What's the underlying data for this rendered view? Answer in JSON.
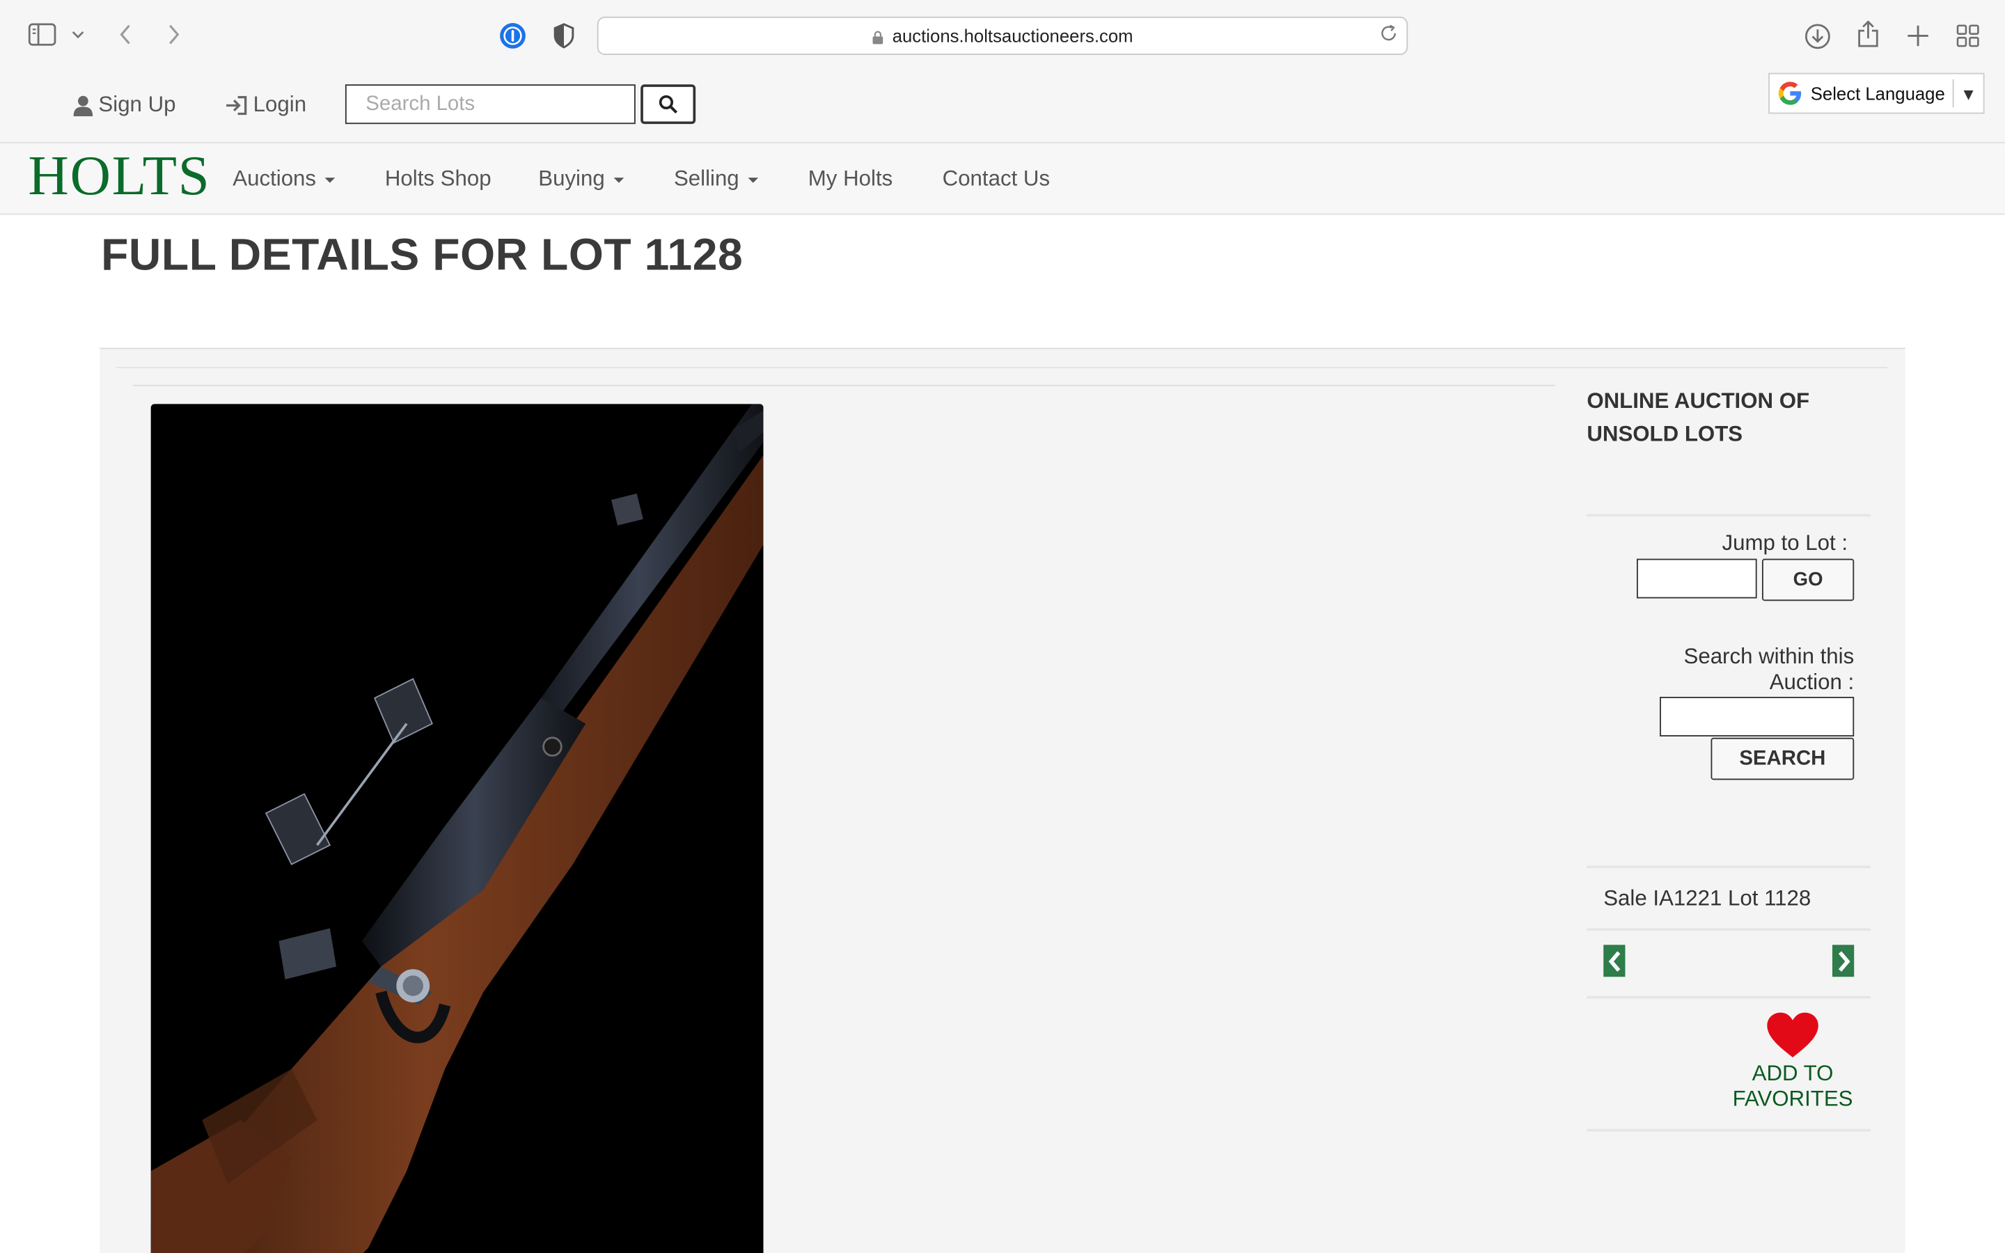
{
  "browser": {
    "url": "auctions.holtsauctioneers.com"
  },
  "top_bar": {
    "sign_up": "Sign Up",
    "login": "Login",
    "search_placeholder": "Search Lots",
    "language": "Select Language"
  },
  "nav": {
    "logo": "HOLTS",
    "items": [
      {
        "label": "Auctions",
        "dropdown": true
      },
      {
        "label": "Holts Shop",
        "dropdown": false
      },
      {
        "label": "Buying",
        "dropdown": true
      },
      {
        "label": "Selling",
        "dropdown": true
      },
      {
        "label": "My Holts",
        "dropdown": false
      },
      {
        "label": "Contact Us",
        "dropdown": false
      }
    ]
  },
  "page": {
    "title": "FULL DETAILS FOR LOT 1128"
  },
  "sidebar": {
    "auction_title": "ONLINE AUCTION OF UNSOLD LOTS",
    "jump_label": "Jump to Lot :",
    "go_label": "GO",
    "search_within_label": "Search within this Auction :",
    "search_label": "SEARCH",
    "sale_label": "Sale IA1221 Lot 1128",
    "favorites_label_1": "ADD TO",
    "favorites_label_2": "FAVORITES"
  },
  "colors": {
    "brand_green": "#0b6b2a",
    "arrow_green": "#2e7d4a",
    "heart_red": "#e30a17"
  }
}
